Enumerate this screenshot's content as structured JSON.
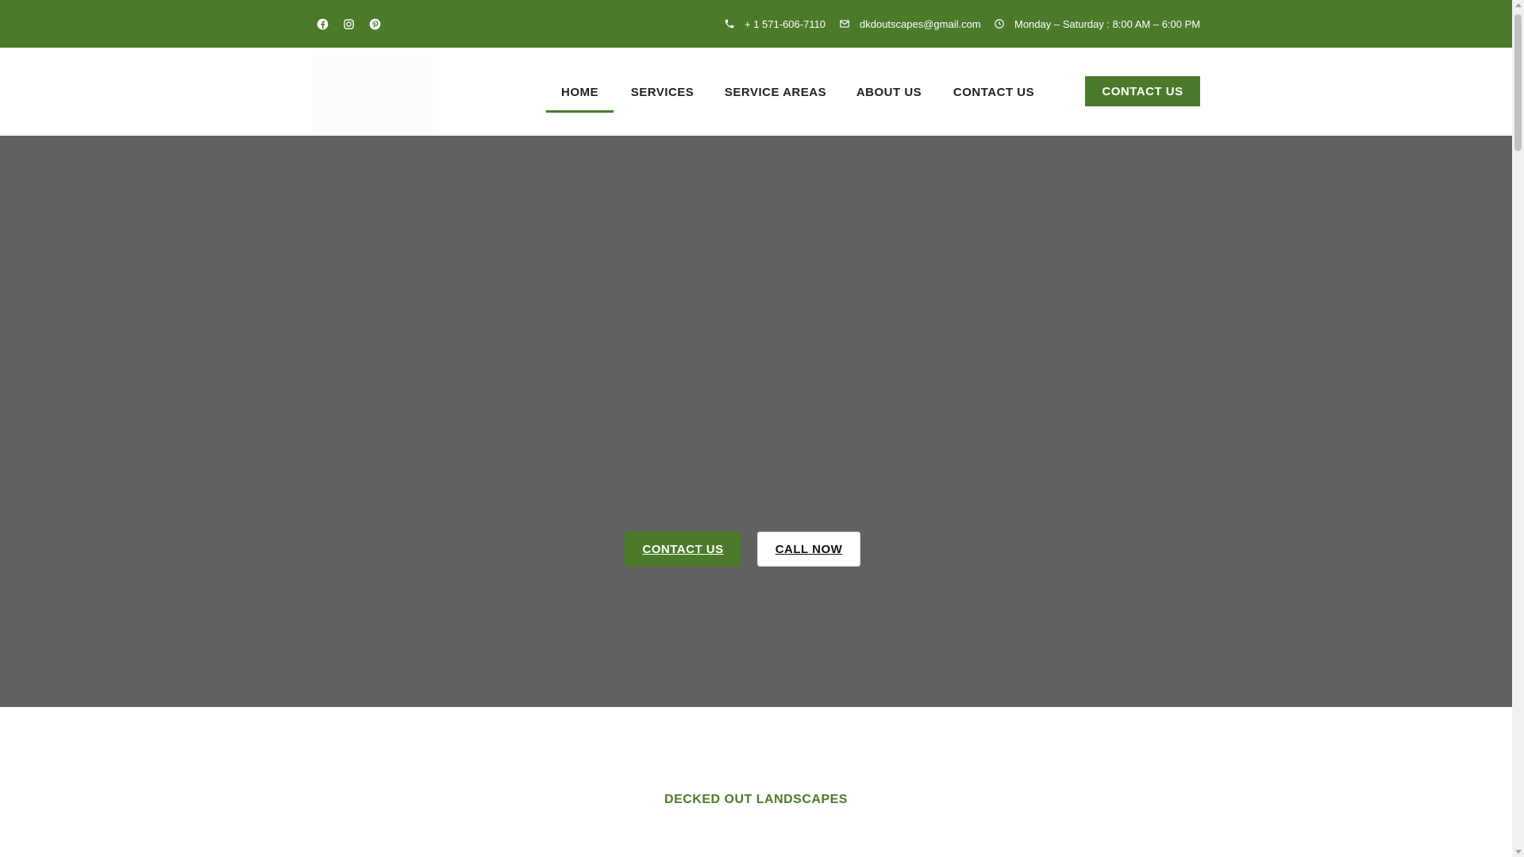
{
  "topbar": {
    "social": [
      {
        "icon": "facebook-icon"
      },
      {
        "icon": "instagram-icon"
      },
      {
        "icon": "pinterest-icon"
      }
    ],
    "phone": "+ 1 571-606-7110",
    "email": "dkdoutscapes@gmail.com",
    "hours": "Monday – Saturday : 8:00 AM – 6:00 PM"
  },
  "nav": {
    "items": [
      {
        "label": "HOME",
        "active": true
      },
      {
        "label": "SERVICES"
      },
      {
        "label": "SERVICE AREAS"
      },
      {
        "label": "ABOUT US"
      },
      {
        "label": "CONTACT US"
      }
    ],
    "cta": "CONTACT US"
  },
  "hero": {
    "primary_button": "CONTACT US",
    "secondary_button": "CALL NOW"
  },
  "section": {
    "title": "DECKED OUT LANDSCAPES"
  },
  "colors": {
    "brand_green": "#4a7a2a",
    "hero_overlay": "#616161"
  }
}
